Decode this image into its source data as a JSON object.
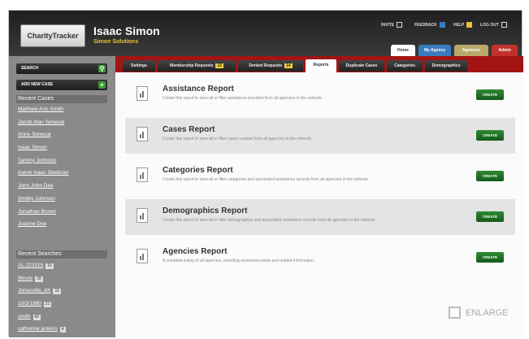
{
  "header": {
    "logo": "CharityTracker",
    "user_name": "Isaac Simon",
    "org_name": "Simon Solutions",
    "util_links": [
      "INVITE",
      "FEEDBACK",
      "HELP",
      "LOG OUT"
    ],
    "primary_tabs": [
      {
        "label": "Home",
        "color": "#ffffff",
        "text_color": "#333333"
      },
      {
        "label": "My Agency",
        "color": "#3a7bbf",
        "text_color": "#ffffff"
      },
      {
        "label": "Agencies",
        "color": "#b9a96b",
        "text_color": "#ffffff"
      },
      {
        "label": "Admin",
        "color": "#c0322b",
        "text_color": "#ffffff"
      }
    ]
  },
  "sidebar": {
    "search_label": "SEARCH",
    "add_case_label": "ADD NEW CASE",
    "recent_cases_heading": "Recent Cases",
    "recent_cases": [
      "Matthew Ario Smith",
      "Jacob Alan Senecal",
      "Anne Senecal",
      "Isaac Simon",
      "Tammy Johnson",
      "Aaron Isaac Stedman",
      "John John Dee",
      "Smiley Johnson",
      "Jonathan Brown",
      "Joanne Doe"
    ],
    "recent_searches_heading": "Recent Searches",
    "recent_searches": [
      {
        "label": "AL 223315",
        "count": "16"
      },
      {
        "label": "Illinois",
        "count": "28"
      },
      {
        "label": "Jonesville, AK",
        "count": "16"
      },
      {
        "label": "10/3/1980",
        "count": "21"
      },
      {
        "label": "smith",
        "count": "42"
      },
      {
        "label": "catherine jenkins",
        "count": "4"
      }
    ]
  },
  "main_tabs": [
    {
      "label": "Settings"
    },
    {
      "label": "Membership Requests",
      "count": "12"
    },
    {
      "label": "Denied Requests",
      "count": "14"
    },
    {
      "label": "Reports"
    },
    {
      "label": "Duplicate Cases"
    },
    {
      "label": "Categories"
    },
    {
      "label": "Demographics"
    }
  ],
  "active_tab": "Reports",
  "reports": [
    {
      "title": "Assistance Report",
      "desc": "Create this report to view all or filter assistance provided from all agencies in the network."
    },
    {
      "title": "Cases Report",
      "desc": "Create this report to view all or filter cases created from all agencies in the network."
    },
    {
      "title": "Categories Report",
      "desc": "Create this report to view all or filter categories and associated assistance records from all agencies in the network."
    },
    {
      "title": "Demographics Report",
      "desc": "Create this report to view all or filter demographics and associated assistance records from all agencies in the network."
    },
    {
      "title": "Agencies Report",
      "desc": "A complete listing of all agencies, including assistance totals and related information."
    }
  ],
  "create_label": "CREATE",
  "enlarge_label": "ENLARGE"
}
